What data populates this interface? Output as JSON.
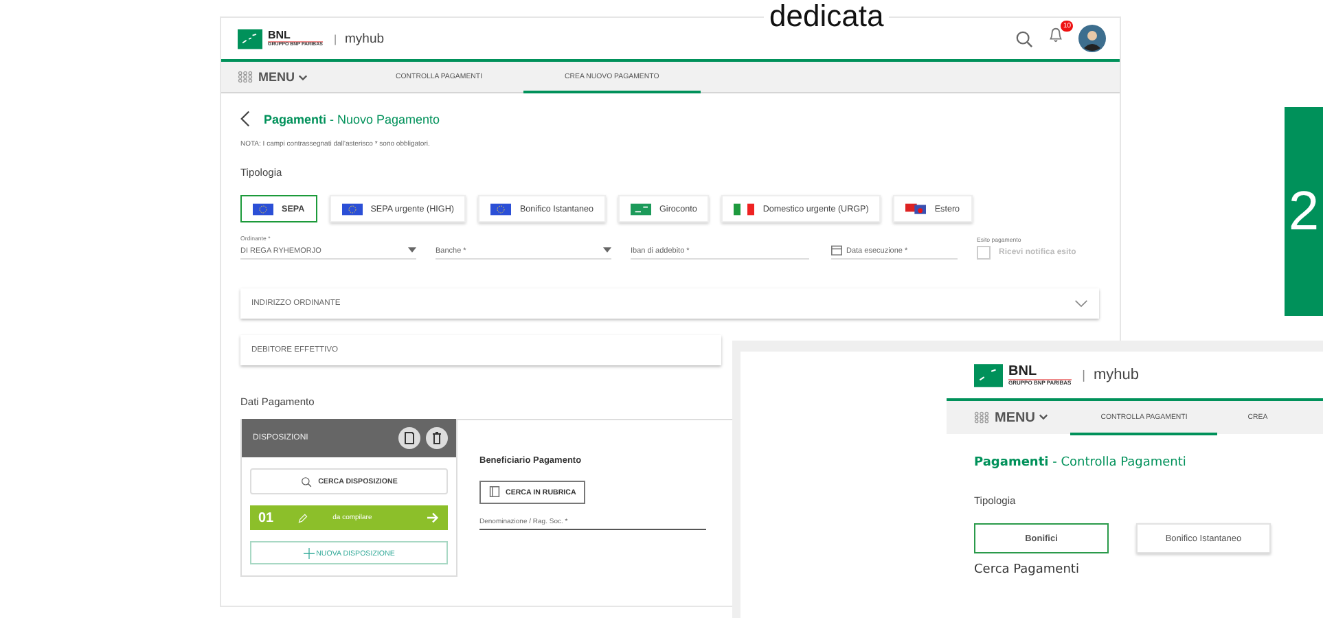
{
  "slide": {
    "title_fragment": "dedicata",
    "badge": "2"
  },
  "screen_main": {
    "header": {
      "brand": "BNL",
      "brand_sub": "GRUPPO BNP PARIBAS",
      "separator": "|",
      "app": "myhub",
      "notification_count": "10"
    },
    "nav": {
      "menu": "MENU",
      "tabs": [
        {
          "label": "CONTROLLA PAGAMENTI",
          "selected": false
        },
        {
          "label": "CREA NUOVO PAGAMENTO",
          "selected": true
        }
      ]
    },
    "title": {
      "section": "Pagamenti",
      "page": "- Nuovo Pagamento"
    },
    "note": "NOTA: I campi contrassegnati dall'asterisco * sono obbligatori.",
    "type_label": "Tipologia",
    "types": [
      {
        "label": "SEPA",
        "selected": true,
        "kind": "eu"
      },
      {
        "label": "SEPA urgente (HIGH)",
        "selected": false,
        "kind": "eu"
      },
      {
        "label": "Bonifico Istantaneo",
        "selected": false,
        "kind": "eu"
      },
      {
        "label": "Giroconto",
        "selected": false,
        "kind": "transfer"
      },
      {
        "label": "Domestico urgente (URGP)",
        "selected": false,
        "kind": "italy"
      },
      {
        "label": "Estero",
        "selected": false,
        "kind": "foreign"
      }
    ],
    "fields": [
      {
        "kind": "select",
        "label": "Ordinante *",
        "value": "DI REGA RYHEMORJO"
      },
      {
        "kind": "select",
        "placeholder": "Banche *"
      },
      {
        "kind": "text",
        "placeholder": "Iban di addebito *"
      },
      {
        "kind": "date",
        "placeholder": "Data esecuzione *"
      },
      {
        "kind": "checkbox",
        "label": "Esito pagamento",
        "text": "Ricevi notifica esito",
        "checked": false
      }
    ],
    "sections": [
      {
        "label": "INDIRIZZO ORDINANTE",
        "expanded": false
      },
      {
        "label": "DEBITORE EFFETTIVO"
      }
    ],
    "payment": {
      "heading": "Dati Pagamento",
      "list_title": "DISPOSIZIONI",
      "search_button": "CERCA DISPOSIZIONE",
      "items": [
        {
          "number": "01",
          "status": "da compilare",
          "selected": true
        }
      ],
      "new_button": "NUOVA DISPOSIZIONE",
      "beneficiary_heading": "Beneficiario Pagamento",
      "address_book_button": "CERCA IN RUBRICA",
      "name_field": {
        "placeholder": "Denominazione / Rag. Soc. *"
      }
    }
  },
  "screen_overlay": {
    "header": {
      "brand": "BNL",
      "brand_sub": "GRUPPO BNP PARIBAS",
      "separator": "|",
      "app": "myhub"
    },
    "nav": {
      "menu": "MENU",
      "tabs": [
        {
          "label": "CONTROLLA PAGAMENTI",
          "selected": true
        },
        {
          "label": "CREA",
          "selected": false
        }
      ]
    },
    "title": {
      "section": "Pagamenti",
      "page": "- Controlla Pagamenti"
    },
    "type_label": "Tipologia",
    "types": [
      {
        "label": "Bonifici",
        "selected": true
      },
      {
        "label": "Bonifico Istantaneo",
        "selected": false
      }
    ],
    "search_heading": "Cerca Pagamenti"
  }
}
